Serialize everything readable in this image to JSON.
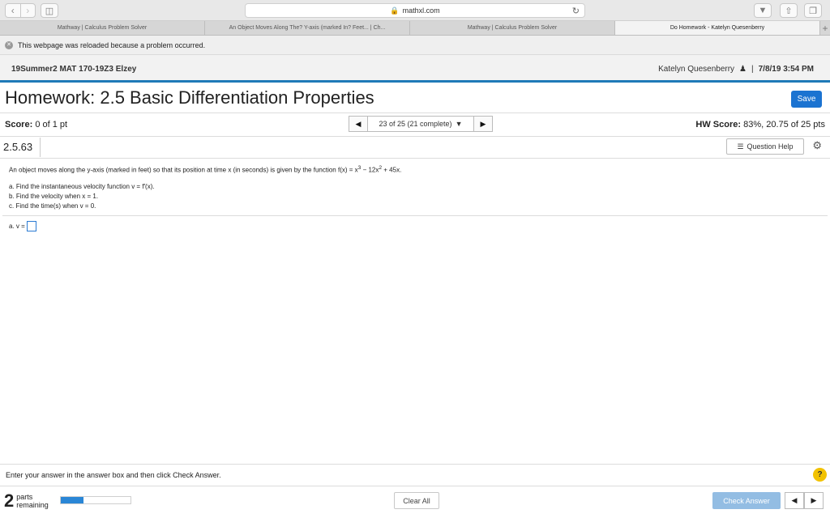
{
  "browser": {
    "address": "mathxl.com",
    "tabs": [
      {
        "label": "Mathway | Calculus Problem Solver"
      },
      {
        "label": "An Object Moves Along The? Y-axis (marked In? Feet... | Ch..."
      },
      {
        "label": "Mathway | Calculus Problem Solver"
      },
      {
        "label": "Do Homework - Katelyn Quesenberry"
      }
    ],
    "reload_message": "This webpage was reloaded because a problem occurred."
  },
  "course": {
    "name": "19Summer2 MAT 170-19Z3 Elzey",
    "user": "Katelyn Quesenberry",
    "separator": "|",
    "datetime": "7/8/19 3:54 PM"
  },
  "homework": {
    "title": "Homework: 2.5 Basic Differentiation Properties",
    "save_label": "Save",
    "score_label": "Score:",
    "score_value": "0 of 1 pt",
    "question_position": "23 of 25 (21 complete)",
    "hw_score_label": "HW Score:",
    "hw_score_value": "83%, 20.75 of 25 pts",
    "question_id": "2.5.63",
    "question_help_label": "Question Help"
  },
  "problem": {
    "statement_prefix": "An object moves along the y-axis (marked in feet) so that its position at time x (in seconds) is given by the function f(x) = x",
    "exp1": "3",
    "mid": " − 12x",
    "exp2": "2",
    "suffix": " + 45x.",
    "part_a": "a. Find the instantaneous velocity function v = f′(x).",
    "part_b": "b. Find the velocity when x = 1.",
    "part_c": "c. Find the time(s) when v = 0.",
    "answer_label": "a. v ="
  },
  "footer": {
    "instruction": "Enter your answer in the answer box and then click Check Answer.",
    "help_symbol": "?",
    "parts_count": "2",
    "parts_word": "parts",
    "remaining_word": "remaining",
    "progress_fraction": 0.33,
    "clear_label": "Clear All",
    "check_label": "Check Answer"
  },
  "colors": {
    "accent": "#1b73d1",
    "header_rule": "#1f7ab8",
    "check_button": "#93bde3",
    "help": "#f2c200"
  }
}
